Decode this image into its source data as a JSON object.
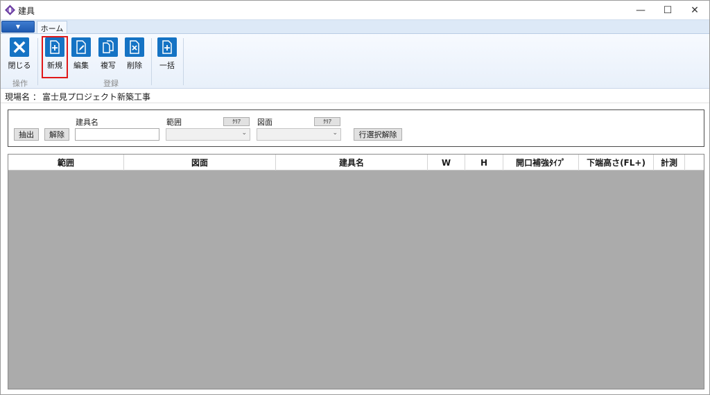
{
  "window": {
    "title": "建具",
    "icon": "app-logo-icon",
    "controls": {
      "minimize": "—",
      "maximize": "☐",
      "close": "✕"
    }
  },
  "ribbon": {
    "menu_button": "▼",
    "tabs": [
      {
        "label": "ホーム",
        "active": true
      }
    ],
    "groups": [
      {
        "label": "操作",
        "buttons": [
          {
            "label": "閉じる",
            "icon": "close-x-icon"
          }
        ]
      },
      {
        "label": "登録",
        "buttons": [
          {
            "label": "新規",
            "icon": "new-document-icon"
          },
          {
            "label": "編集",
            "icon": "edit-document-icon"
          },
          {
            "label": "複写",
            "icon": "copy-document-icon"
          },
          {
            "label": "削除",
            "icon": "delete-document-icon"
          }
        ]
      },
      {
        "label": "",
        "buttons": [
          {
            "label": "一括",
            "icon": "bulk-add-icon"
          }
        ]
      }
    ],
    "highlight_color": "#e01818",
    "accent_color": "#1573c4"
  },
  "site": {
    "label": "現場名 ：",
    "value": "富士見プロジェクト新築工事"
  },
  "filter": {
    "extract_button": "抽出",
    "clear_button": "解除",
    "fitting_name_label": "建具名",
    "fitting_name_value": "",
    "range_label": "範囲",
    "range_clear": "ｸﾘｱ",
    "range_value": "",
    "drawing_label": "図面",
    "drawing_clear": "ｸﾘｱ",
    "drawing_value": "",
    "row_deselect_button": "行選択解除"
  },
  "grid": {
    "columns": [
      "範囲",
      "図面",
      "建具名",
      "W",
      "H",
      "開口補強ﾀｲﾌﾟ",
      "下端高さ(FL+)",
      "計測"
    ],
    "rows": [],
    "empty_background": "#ababab"
  }
}
